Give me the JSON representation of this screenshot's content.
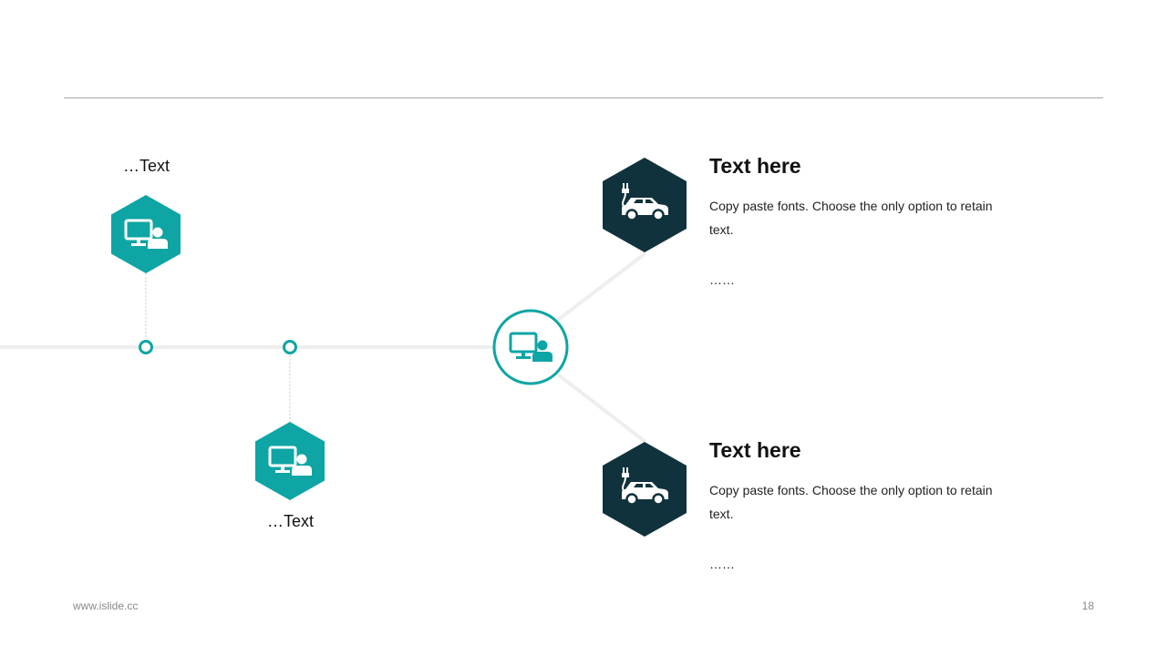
{
  "colors": {
    "teal": "#0ea5a4",
    "navy": "#10323c",
    "line": "#eeeeee",
    "rule": "#a6a6a6"
  },
  "left_nodes": [
    {
      "label": "…Text",
      "icon": "monitor-user-icon"
    },
    {
      "label": "…Text",
      "icon": "monitor-user-icon"
    }
  ],
  "center_node": {
    "icon": "monitor-user-icon"
  },
  "right_items": [
    {
      "title": "Text here",
      "description": "Copy paste fonts. Choose the only option to retain text.",
      "ellipsis": "……",
      "icon": "electric-car-icon"
    },
    {
      "title": "Text here",
      "description": "Copy paste fonts. Choose the only option to retain text.",
      "ellipsis": "……",
      "icon": "electric-car-icon"
    }
  ],
  "footer": {
    "website": "www.islide.cc",
    "page_number": "18"
  }
}
